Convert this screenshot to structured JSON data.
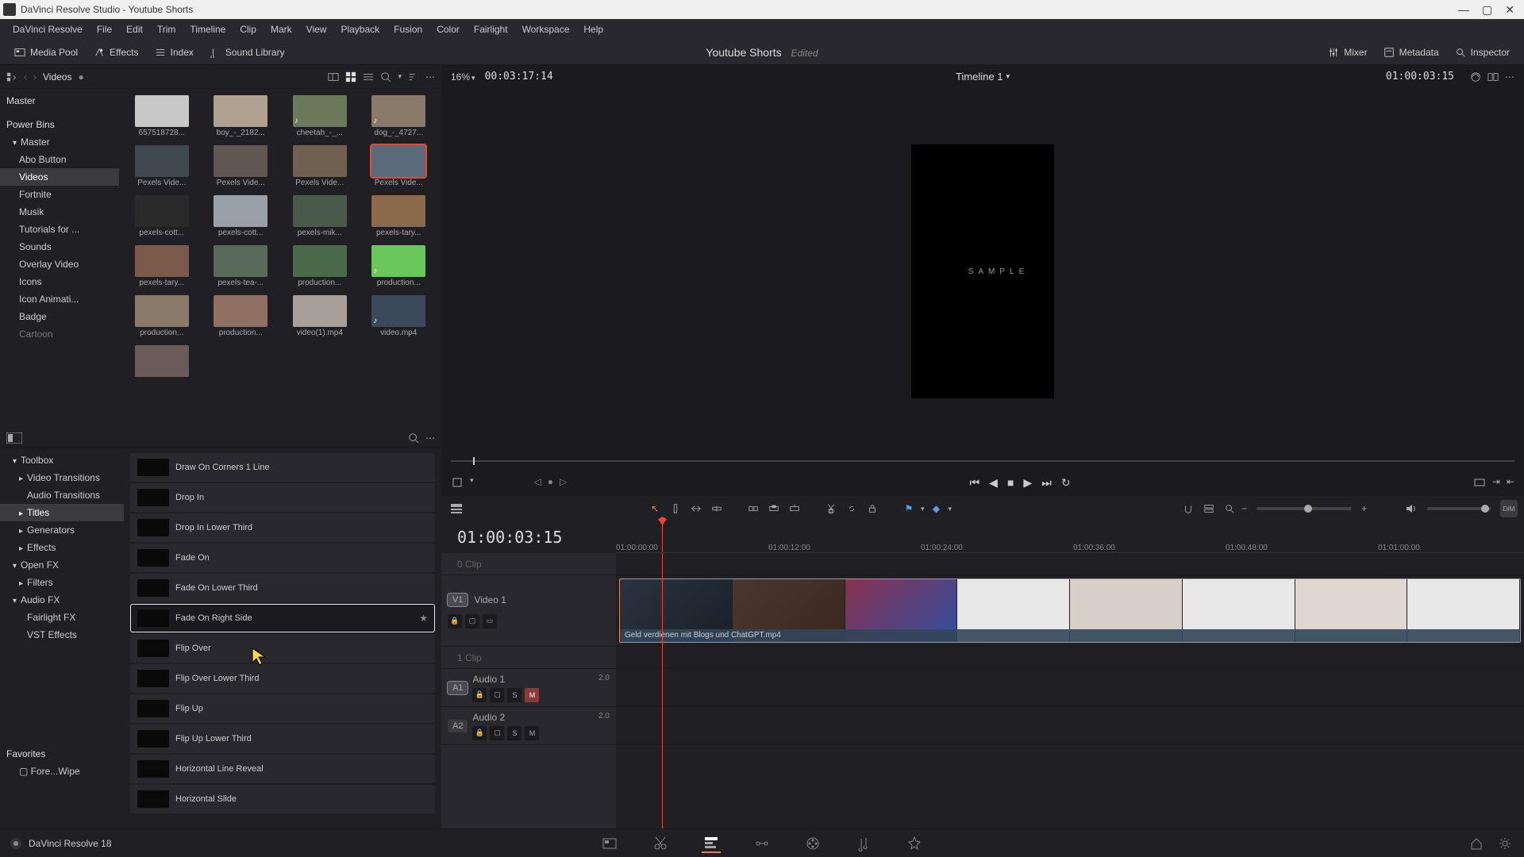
{
  "window": {
    "title": "DaVinci Resolve Studio - Youtube Shorts"
  },
  "menu": [
    "DaVinci Resolve",
    "File",
    "Edit",
    "Trim",
    "Timeline",
    "Clip",
    "Mark",
    "View",
    "Playback",
    "Fusion",
    "Color",
    "Fairlight",
    "Workspace",
    "Help"
  ],
  "toolbar": {
    "media_pool": "Media Pool",
    "effects": "Effects",
    "index": "Index",
    "sound_library": "Sound Library",
    "project": "Youtube Shorts",
    "edited": "Edited",
    "mixer": "Mixer",
    "metadata": "Metadata",
    "inspector": "Inspector"
  },
  "media": {
    "breadcrumb": "Videos",
    "tree_root": "Master",
    "power_bins": "Power Bins",
    "tree": [
      "Master",
      "Abo Button",
      "Videos",
      "Fortnite",
      "Musik",
      "Tutorials for ...",
      "Sounds",
      "Overlay Video",
      "Icons",
      "Icon Animati...",
      "Badge",
      "Cartoon"
    ],
    "tree_active": "Videos",
    "clips": [
      "657518728...",
      "boy_-_2182...",
      "cheetah_-_...",
      "dog_-_4727...",
      "Pexels Vide...",
      "Pexels Vide...",
      "Pexels Vide...",
      "Pexels Vide...",
      "pexels-cott...",
      "pexels-cott...",
      "pexels-mik...",
      "pexels-tary...",
      "pexels-tary...",
      "pexels-tea-...",
      "production...",
      "production...",
      "production...",
      "production...",
      "video(1).mp4",
      "video.mp4"
    ],
    "selected_clip_index": 7
  },
  "effects": {
    "toolbox": "Toolbox",
    "categories": [
      "Video Transitions",
      "Audio Transitions",
      "Titles",
      "Generators",
      "Effects"
    ],
    "openfx": "Open FX",
    "openfx_sub": [
      "Filters"
    ],
    "audiofx": "Audio FX",
    "audiofx_sub": [
      "Fairlight FX",
      "VST Effects"
    ],
    "active_category": "Titles",
    "list": [
      "Draw On Corners 1 Line",
      "Drop In",
      "Drop In Lower Third",
      "Fade On",
      "Fade On Lower Third",
      "Fade On Right Side",
      "Flip Over",
      "Flip Over Lower Third",
      "Flip Up",
      "Flip Up Lower Third",
      "Horizontal Line Reveal",
      "Horizontal Slide"
    ],
    "selected": "Fade On Right Side",
    "favorites_label": "Favorites",
    "favorites": [
      "Fore...Wipe"
    ]
  },
  "viewer": {
    "zoom": "16%",
    "src_tc": "00:03:17:14",
    "timeline_name": "Timeline 1",
    "rec_tc": "01:00:03:15",
    "sample": "SAMPLE"
  },
  "timeline": {
    "tc": "01:00:03:15",
    "ticks": [
      "01:00:00:00",
      "01:00:12:00",
      "01:00:24:00",
      "01:00:36:00",
      "01:00:48:00",
      "01:01:00:00"
    ],
    "clip0": "0 Clip",
    "v1_badge": "V1",
    "v1": "Video 1",
    "clip1": "1 Clip",
    "a1_badge": "A1",
    "a1": "Audio 1",
    "a1_ch": "2.0",
    "a2_badge": "A2",
    "a2": "Audio 2",
    "a2_ch": "2.0",
    "clip_name": "Geld verdienen mit Blogs und ChatGPT.mp4"
  },
  "footer": {
    "version": "DaVinci Resolve 18"
  }
}
